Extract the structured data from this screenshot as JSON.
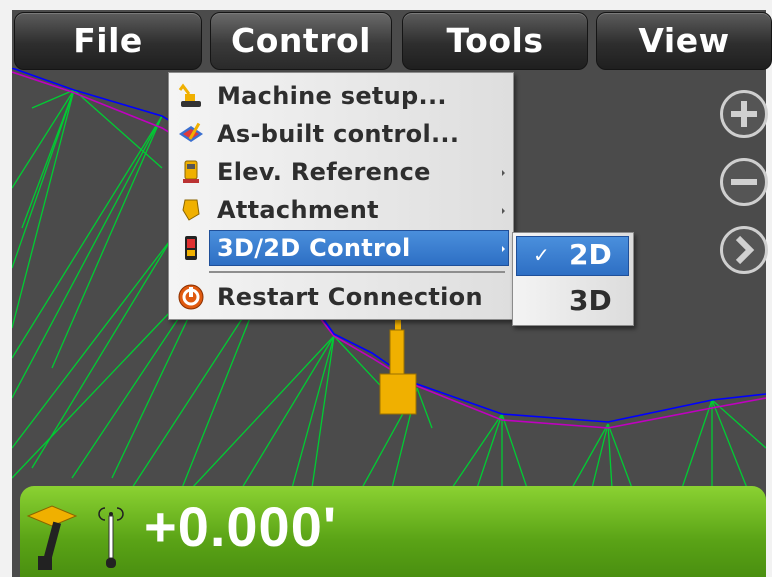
{
  "menubar": {
    "items": [
      {
        "label": "File"
      },
      {
        "label": "Control"
      },
      {
        "label": "Tools"
      },
      {
        "label": "View"
      }
    ]
  },
  "control_menu": {
    "items": [
      {
        "label": "Machine setup...",
        "icon": "excavator-icon",
        "submenu": false
      },
      {
        "label": "As-built control...",
        "icon": "as-built-icon",
        "submenu": false
      },
      {
        "label": "Elev. Reference",
        "icon": "elevation-reference-icon",
        "submenu": true
      },
      {
        "label": "Attachment",
        "icon": "bucket-icon",
        "submenu": true
      },
      {
        "label": "3D/2D Control",
        "icon": "control-unit-icon",
        "submenu": true,
        "selected": true
      },
      {
        "label": "Restart Connection",
        "icon": "restart-icon",
        "submenu": false
      }
    ]
  },
  "control_submenu": {
    "items": [
      {
        "label": "2D",
        "checked": true,
        "check_glyph": "✓"
      },
      {
        "label": "3D",
        "checked": false
      }
    ]
  },
  "map_controls": {
    "zoom_in_icon": "plus-icon",
    "zoom_out_icon": "minus-icon",
    "next_icon": "chevron-right-icon"
  },
  "status": {
    "value": "+0.000'"
  },
  "colors": {
    "map_background": "#4b4b4b",
    "design_line": "#0000ff",
    "surface_line": "#c000c0",
    "grid_lines": "#00cc33",
    "status_bar": "#6cb81f",
    "highlight": "#3a7fd0",
    "machine": "#f0b000"
  }
}
